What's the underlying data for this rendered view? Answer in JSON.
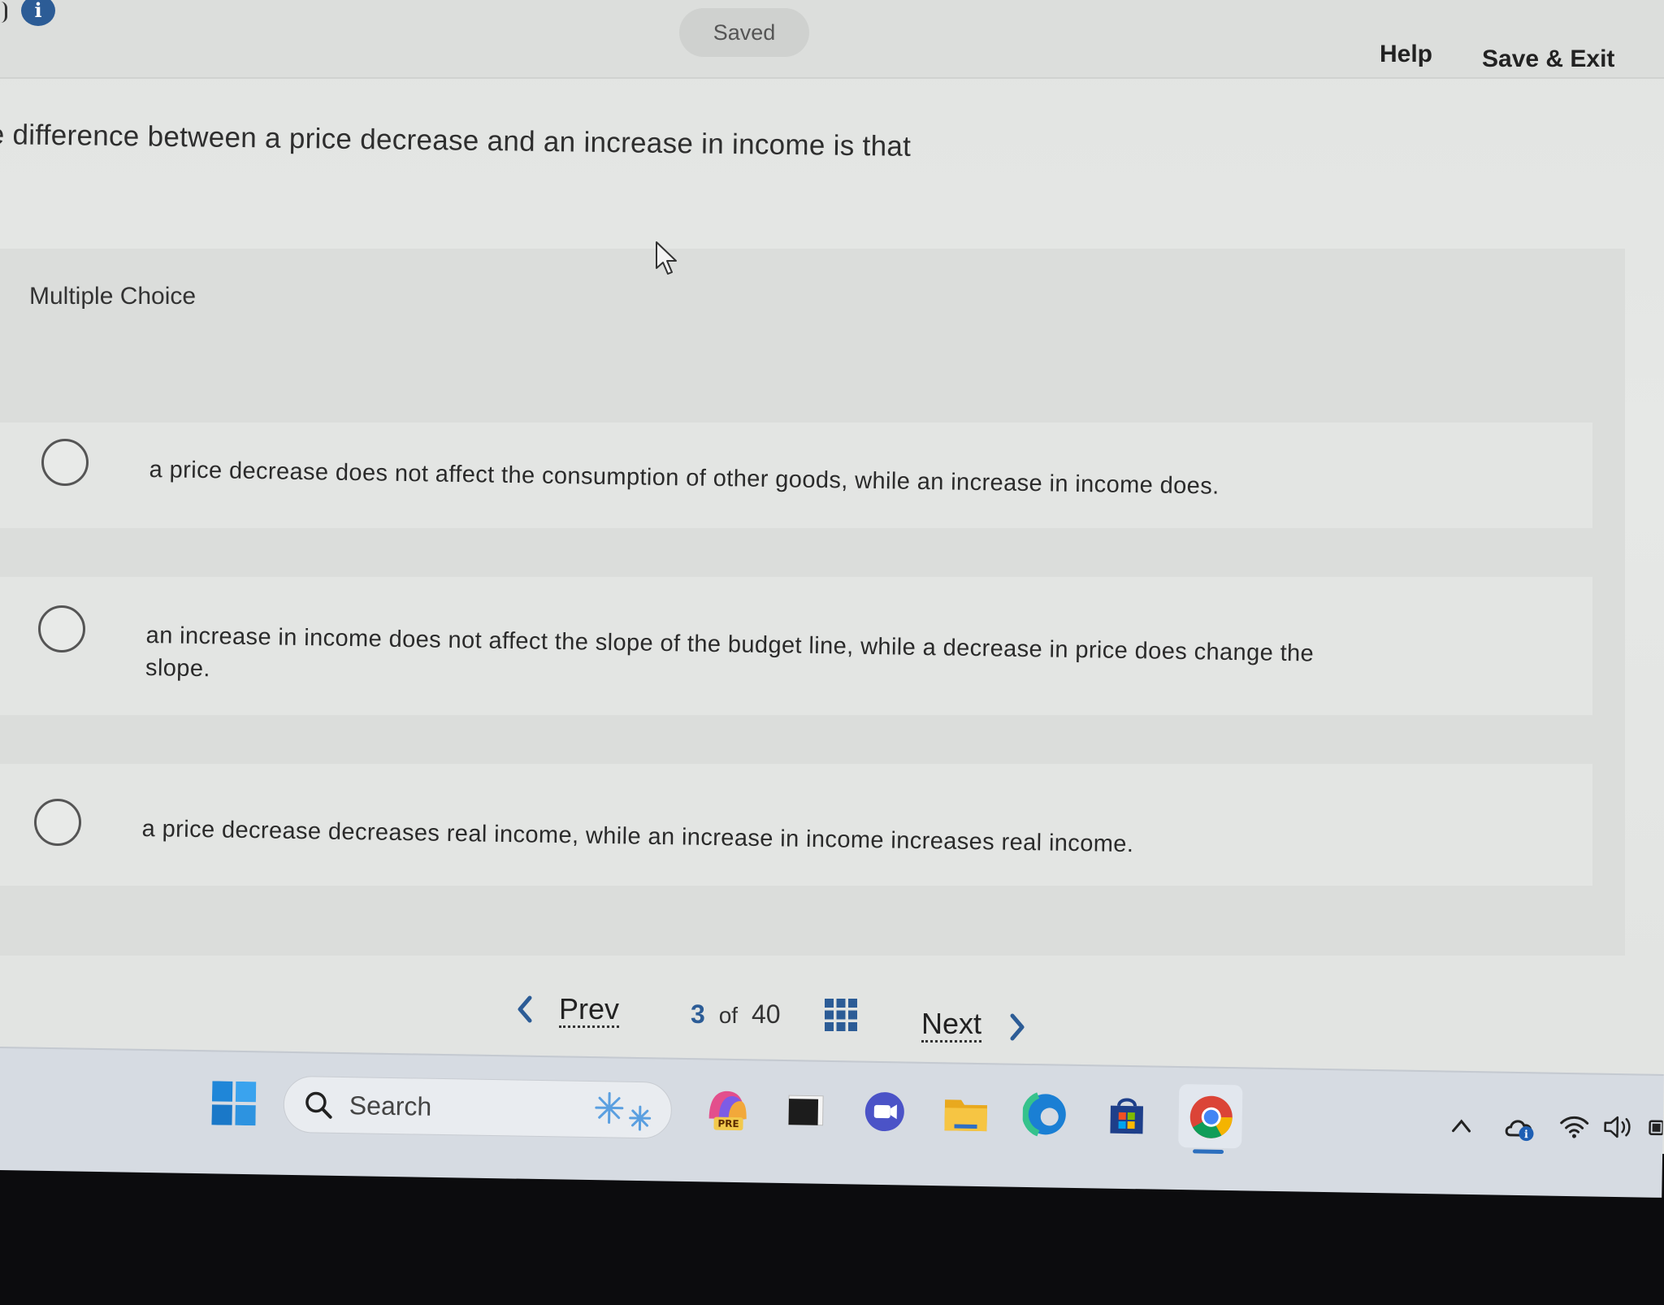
{
  "header": {
    "saved_status": "Saved",
    "help_label": "Help",
    "save_exit_label": "Save & Exit",
    "info_icon": "i"
  },
  "question": {
    "text": "e difference between a price decrease and an increase in income is that"
  },
  "choices": {
    "label": "Multiple Choice",
    "options": [
      {
        "text": "a price decrease does not affect the consumption of other goods, while an increase in income does."
      },
      {
        "line1": "an increase in income does not affect the slope of the budget line, while a decrease in price does change the",
        "line2": "slope."
      },
      {
        "text": "a price decrease decreases real income, while an increase in income increases real income."
      }
    ]
  },
  "pagination": {
    "prev_label": "Prev",
    "current_page": "3",
    "of_label": "of",
    "total_pages": "40",
    "next_label": "Next"
  },
  "taskbar": {
    "search_placeholder": "Search",
    "apps": [
      "start-windows-icon",
      "weather-snow-icon",
      "copilot-pre-icon",
      "file-viewer-icon",
      "meet-icon",
      "file-explorer-icon",
      "edge-icon",
      "microsoft-store-icon",
      "chrome-icon"
    ],
    "preview_badge": "PRE"
  },
  "tray": {
    "icons": [
      "chevron-up-icon",
      "onedrive-icon",
      "wifi-icon",
      "volume-icon",
      "battery-icon"
    ]
  },
  "colors": {
    "accent": "#2c5c96",
    "page_background": "#e2e4e2",
    "panel_background": "#dbdddb",
    "taskbar": "#d6dbe2"
  }
}
